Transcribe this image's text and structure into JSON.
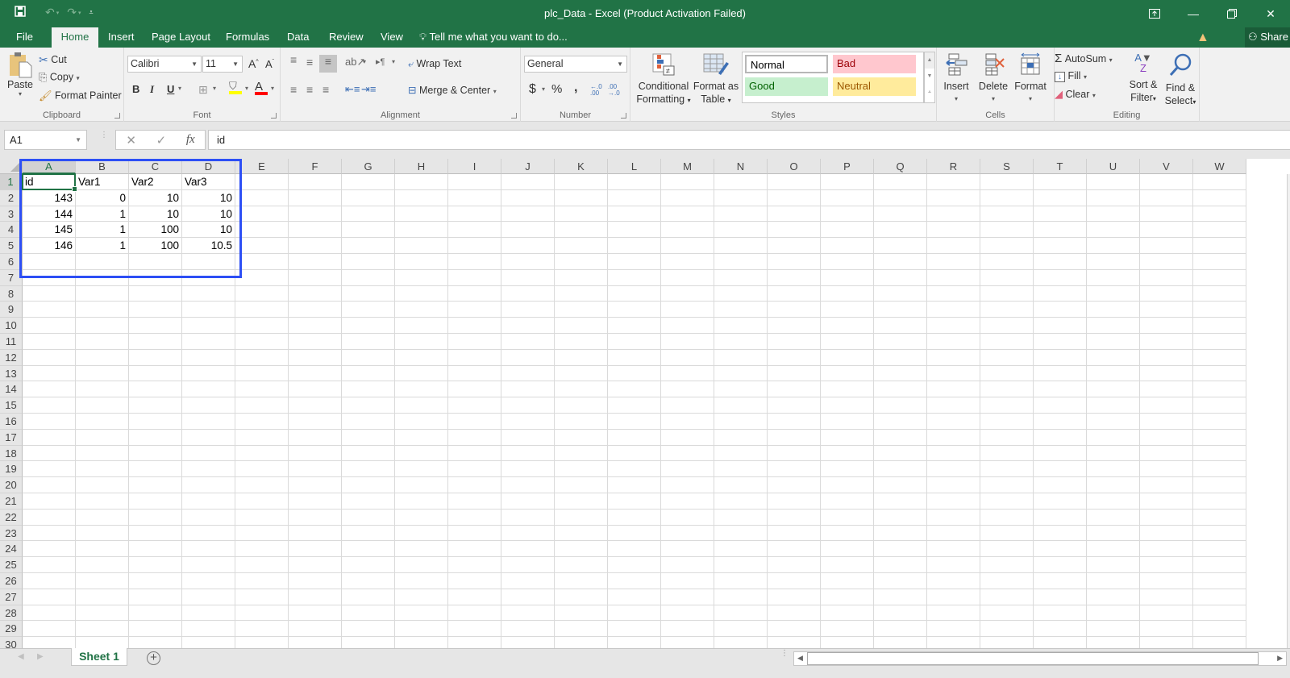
{
  "titlebar": {
    "title": "plc_Data - Excel (Product Activation Failed)",
    "qat": {
      "save_icon": "save-icon",
      "undo_icon": "undo-icon",
      "redo_icon": "redo-icon",
      "customize_icon": "customize-qat-icon"
    },
    "window_controls": [
      "ribbon-display-options-icon",
      "minimize-icon",
      "restore-icon",
      "close-icon"
    ]
  },
  "tabs": [
    {
      "label": "File",
      "active": false
    },
    {
      "label": "Home",
      "active": true
    },
    {
      "label": "Insert",
      "active": false
    },
    {
      "label": "Page Layout",
      "active": false
    },
    {
      "label": "Formulas",
      "active": false
    },
    {
      "label": "Data",
      "active": false
    },
    {
      "label": "Review",
      "active": false
    },
    {
      "label": "View",
      "active": false
    }
  ],
  "tellme": "Tell me what you want to do...",
  "share_label": "Share",
  "ribbon": {
    "clipboard": {
      "label": "Clipboard",
      "paste": "Paste",
      "cut": "Cut",
      "copy": "Copy",
      "format_painter": "Format Painter"
    },
    "font": {
      "label": "Font",
      "font_name": "Calibri",
      "font_size": "11",
      "bold": "B",
      "italic": "I",
      "underline": "U",
      "font_color": "A",
      "fill_color_hex": "#ffff00",
      "font_color_hex": "#ff0000"
    },
    "alignment": {
      "label": "Alignment",
      "wrap_text": "Wrap Text",
      "merge_center": "Merge & Center"
    },
    "number": {
      "label": "Number",
      "format": "General",
      "currency": "$",
      "percent": "%",
      "comma": ",",
      "inc_decimal": "←.0 .00",
      "dec_decimal": ".00 →.0"
    },
    "styles": {
      "label": "Styles",
      "conditional_formatting": [
        "Conditional",
        "Formatting"
      ],
      "format_as_table": [
        "Format as",
        "Table"
      ],
      "gallery": [
        {
          "name": "Normal",
          "bg": "#ffffff",
          "fg": "#000000"
        },
        {
          "name": "Bad",
          "bg": "#ffc7ce",
          "fg": "#9c0006"
        },
        {
          "name": "Good",
          "bg": "#c6efce",
          "fg": "#006100"
        },
        {
          "name": "Neutral",
          "bg": "#ffeb9c",
          "fg": "#9c5700"
        }
      ]
    },
    "cells": {
      "label": "Cells",
      "insert": "Insert",
      "delete": "Delete",
      "format": "Format"
    },
    "editing": {
      "label": "Editing",
      "autosum": "AutoSum",
      "fill": "Fill",
      "clear": "Clear",
      "sort_filter": [
        "Sort &",
        "Filter"
      ],
      "find_select": [
        "Find &",
        "Select"
      ]
    }
  },
  "formula_bar": {
    "name_box": "A1",
    "cancel": "✕",
    "enter": "✓",
    "fx": "fx",
    "content": "id"
  },
  "sheet": {
    "columns": [
      "A",
      "B",
      "C",
      "D",
      "E",
      "F",
      "G",
      "H",
      "I",
      "J",
      "K",
      "L",
      "M",
      "N",
      "O",
      "P",
      "Q",
      "R",
      "S",
      "T",
      "U",
      "V",
      "W"
    ],
    "rows": [
      1,
      2,
      3,
      4,
      5,
      6,
      7,
      8,
      9,
      10,
      11,
      12,
      13,
      14,
      15,
      16,
      17,
      18,
      19,
      20,
      21,
      22,
      23,
      24,
      25,
      26,
      27,
      28,
      29,
      30
    ],
    "selected_cell": "A1",
    "cells": [
      [
        "id",
        "Var1",
        "Var2",
        "Var3"
      ],
      [
        "143",
        "0",
        "10",
        "10"
      ],
      [
        "144",
        "1",
        "10",
        "10"
      ],
      [
        "145",
        "1",
        "100",
        "10"
      ],
      [
        "146",
        "1",
        "100",
        "10.5"
      ]
    ],
    "accent": "#217346",
    "highlight_color": "#2d4ff5"
  },
  "sheet_tabs": [
    {
      "label": "Sheet 1",
      "active": true
    }
  ],
  "add_sheet": "+"
}
